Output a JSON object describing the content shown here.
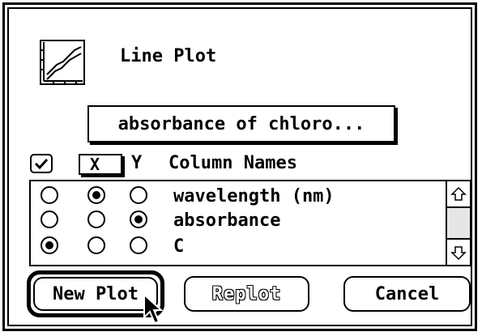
{
  "dialog": {
    "title": "Line Plot",
    "dataset_popup": "absorbance of chloro...",
    "include_checkbox": true,
    "x_header": "X",
    "y_header": "Y",
    "columns_header": "Column Names"
  },
  "columns": [
    {
      "name": "wavelength (nm)",
      "selection": "X"
    },
    {
      "name": "absorbance",
      "selection": "Y"
    },
    {
      "name": "C",
      "selection": "none"
    }
  ],
  "buttons": {
    "new_plot": "New Plot",
    "replot": "Replot",
    "cancel": "Cancel"
  },
  "icons": {
    "plot_icon": "line-plot-icon",
    "scroll_up": "scroll-up-arrow-icon",
    "scroll_down": "scroll-down-arrow-icon",
    "cursor": "arrow-cursor-icon"
  }
}
